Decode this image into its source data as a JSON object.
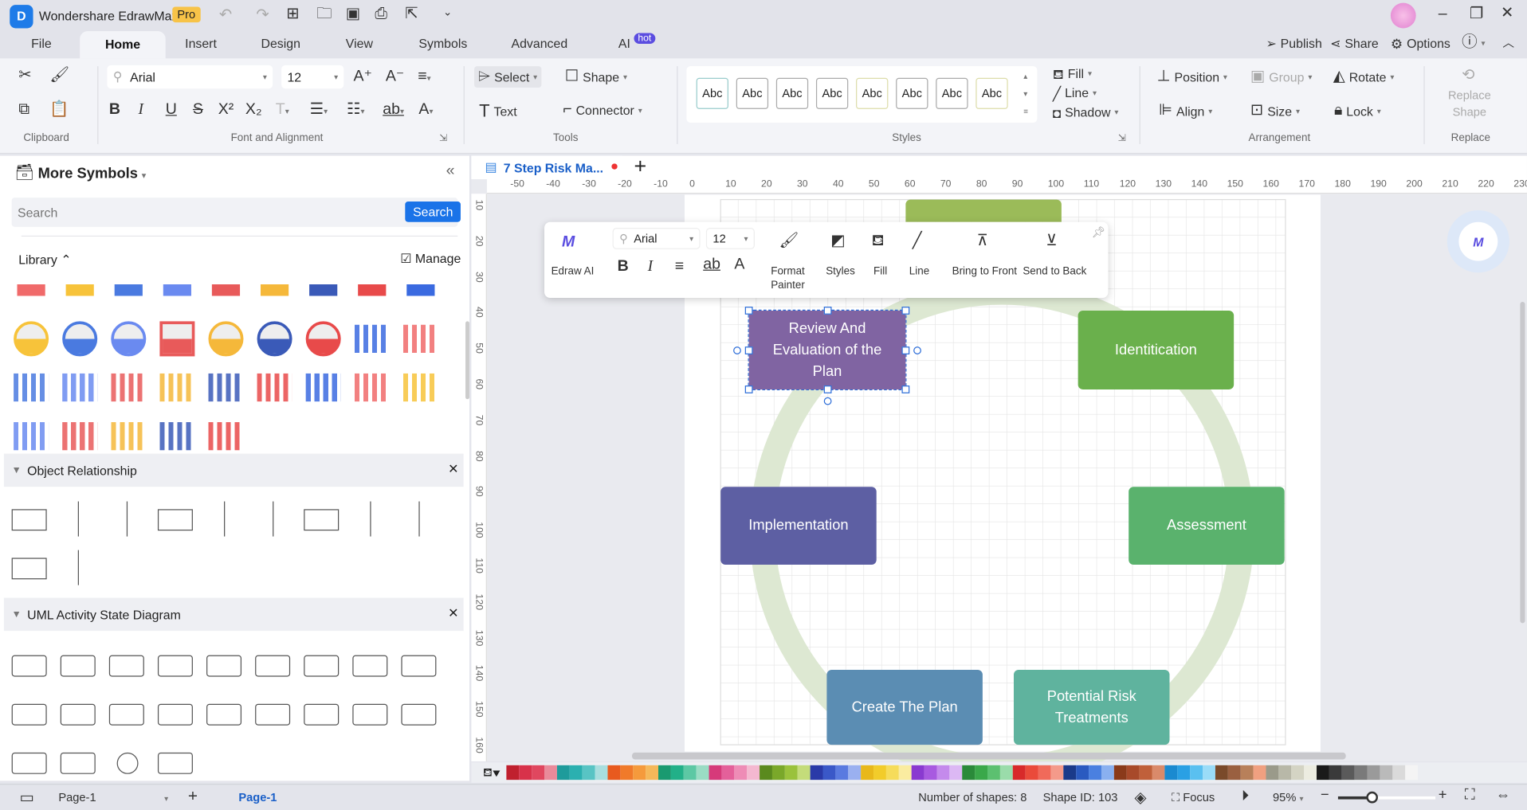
{
  "app": {
    "title": "Wondershare EdrawMax",
    "badge": "Pro"
  },
  "menu_tabs": [
    {
      "label": "File"
    },
    {
      "label": "Home"
    },
    {
      "label": "Insert"
    },
    {
      "label": "Design"
    },
    {
      "label": "View"
    },
    {
      "label": "Symbols"
    },
    {
      "label": "Advanced"
    },
    {
      "label": "AI"
    }
  ],
  "ai_badge": "hot",
  "top_actions": {
    "publish": "Publish",
    "share": "Share",
    "options": "Options"
  },
  "ribbon": {
    "groups": {
      "clipboard": "Clipboard",
      "font": "Font and Alignment",
      "tools": "Tools",
      "styles": "Styles",
      "arrangement": "Arrangement",
      "replace": "Replace"
    },
    "font_name": "Arial",
    "font_size": "12",
    "select": "Select",
    "shape": "Shape",
    "text": "Text",
    "connector": "Connector",
    "style_swatch": "Abc",
    "fill": "Fill",
    "line": "Line",
    "shadow": "Shadow",
    "position": "Position",
    "group": "Group",
    "rotate": "Rotate",
    "align": "Align",
    "size": "Size",
    "lock": "Lock",
    "replace_shape": "Replace Shape"
  },
  "sidebar": {
    "title": "More Symbols",
    "search_placeholder": "Search",
    "search_button": "Search",
    "library": "Library",
    "manage": "Manage",
    "sections": [
      {
        "label": "Object Relationship"
      },
      {
        "label": "UML Activity State Diagram"
      }
    ]
  },
  "document_tab": {
    "title": "7 Step Risk Ma..."
  },
  "ruler": {
    "top": [
      -50,
      -40,
      -30,
      -20,
      -10,
      0,
      10,
      20,
      30,
      40,
      50,
      60,
      70,
      80,
      90,
      100,
      110,
      120,
      130,
      140,
      150,
      160,
      170,
      180,
      190,
      200,
      210,
      220,
      230
    ],
    "left": [
      10,
      20,
      30,
      40,
      50,
      60,
      70,
      80,
      90,
      100,
      110,
      120,
      130,
      140,
      150,
      160
    ]
  },
  "floating_toolbar": {
    "edraw_ai": "Edraw AI",
    "font": "Arial",
    "size": "12",
    "format_painter": "Format Painter",
    "styles": "Styles",
    "fill": "Fill",
    "line": "Line",
    "bring_front": "Bring to Front",
    "send_back": "Send to Back"
  },
  "diagram": {
    "ring_color": "#dde8d2",
    "shapes": [
      {
        "label": "",
        "color": "#9bbb59"
      },
      {
        "label": "Review And Evaluation of the Plan",
        "color": "#8064a2",
        "selected": true
      },
      {
        "label": "Identitication",
        "color": "#6ab04c"
      },
      {
        "label": "Implementation",
        "color": "#5d5fa3"
      },
      {
        "label": "Assessment",
        "color": "#5ab26d"
      },
      {
        "label": "Create The Plan",
        "color": "#5b8db3"
      },
      {
        "label": "Potential Risk Treatments",
        "color": "#5fb39e"
      }
    ]
  },
  "palette": [
    "#c0202e",
    "#d8324a",
    "#e0475f",
    "#e98a9a",
    "#1e9b9b",
    "#2bb0b0",
    "#58c4c4",
    "#a8dede",
    "#e85a1e",
    "#f07a2a",
    "#f59a3c",
    "#f5b85a",
    "#1a9a70",
    "#22b088",
    "#5cc8a4",
    "#9adcc4",
    "#d63a7a",
    "#e4609a",
    "#ee8cb6",
    "#f4b8d0",
    "#5a8a1e",
    "#7aa82a",
    "#9ac23c",
    "#c4dc7a",
    "#2a3aa8",
    "#3a58c8",
    "#5a7ae0",
    "#9ab0f0",
    "#e8b81a",
    "#f2cc2a",
    "#f6dc5a",
    "#faeca0",
    "#8a3ad0",
    "#a85ae0",
    "#c48aec",
    "#dcb8f4",
    "#2a8a3a",
    "#3aa84a",
    "#5cc070",
    "#9adcaa",
    "#d82a2a",
    "#ea4a3a",
    "#f06a5a",
    "#f49a8a",
    "#1a3a8a",
    "#2a5ac0",
    "#4a80e0",
    "#8ab0f0",
    "#8a3a1a",
    "#a84a2a",
    "#c0603a",
    "#da8a6a",
    "#1a8ad0",
    "#2aa0e4",
    "#5ac0f0",
    "#9adcf8",
    "#7a4a2a",
    "#9a6040",
    "#b8805a",
    "#f0a080",
    "#9a9a8a",
    "#b8b8a8",
    "#d4d4c4",
    "#ecece0",
    "#1a1a1a",
    "#3a3a3a",
    "#5a5a5a",
    "#7a7a7a",
    "#9a9a9a",
    "#bababa",
    "#dadada",
    "#f4f4f4"
  ],
  "status": {
    "page_selector": "Page-1",
    "page_tab": "Page-1",
    "shapes_count": "Number of shapes: 8",
    "shape_id": "Shape ID: 103",
    "focus": "Focus",
    "zoom": "95%",
    "zoom_level": 0.35
  }
}
